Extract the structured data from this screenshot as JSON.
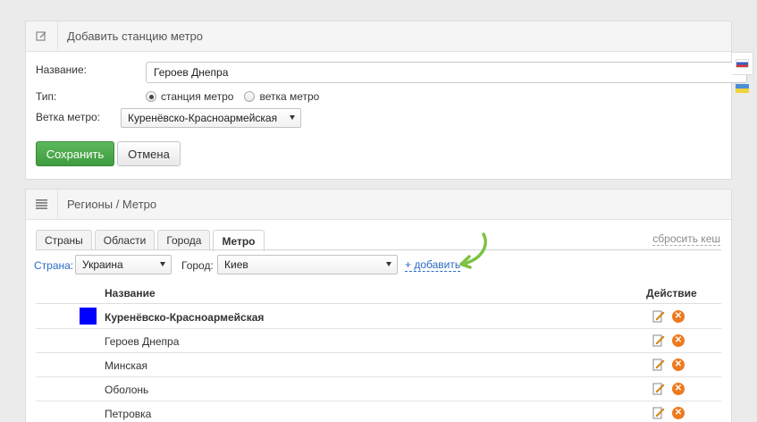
{
  "add_panel": {
    "title": "Добавить станцию метро",
    "name_label": "Название:",
    "name_value": "Героев Днепра",
    "type_label": "Тип:",
    "type_options": [
      {
        "label": "станция метро",
        "selected": true
      },
      {
        "label": "ветка метро",
        "selected": false
      }
    ],
    "branch_label": "Ветка метро:",
    "branch_value": "Куренёвско-Красноармейская",
    "save_label": "Сохранить",
    "cancel_label": "Отмена"
  },
  "languages": [
    "ru-flag-icon",
    "ua-flag-icon"
  ],
  "list_panel": {
    "title": "Регионы / Метро",
    "tabs": [
      {
        "label": "Страны",
        "active": false
      },
      {
        "label": "Области",
        "active": false
      },
      {
        "label": "Города",
        "active": false
      },
      {
        "label": "Метро",
        "active": true
      }
    ],
    "reset_cache": "сбросить кеш",
    "country_label": "Страна:",
    "country_value": "Украина",
    "city_label": "Город:",
    "city_value": "Киев",
    "add_link": "+ добавить",
    "col_name": "Название",
    "col_action": "Действие",
    "rows": [
      {
        "name": "Куренёвско-Красноармейская",
        "bold": true,
        "color": "#0000ff"
      },
      {
        "name": "Героев Днепра",
        "bold": false
      },
      {
        "name": "Минская",
        "bold": false
      },
      {
        "name": "Оболонь",
        "bold": false
      },
      {
        "name": "Петровка",
        "bold": false
      }
    ]
  },
  "colors": {
    "primary_button": "#4cae4c",
    "link": "#2a6bc4",
    "annotation_arrow": "#7cc242",
    "delete_icon": "#ee7a1f"
  }
}
